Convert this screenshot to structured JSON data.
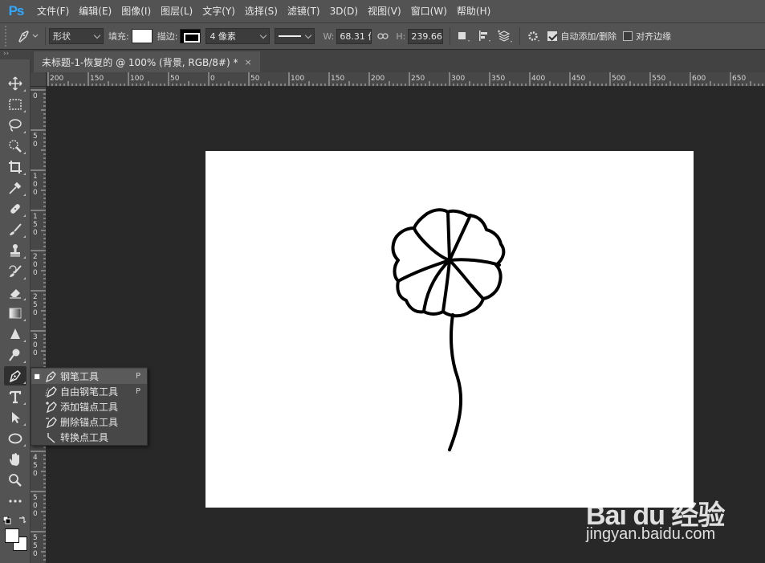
{
  "app": {
    "logo": "Ps"
  },
  "menubar": {
    "items": [
      "文件(F)",
      "编辑(E)",
      "图像(I)",
      "图层(L)",
      "文字(Y)",
      "选择(S)",
      "滤镜(T)",
      "3D(D)",
      "视图(V)",
      "窗口(W)",
      "帮助(H)"
    ]
  },
  "options": {
    "mode": "形状",
    "fill_label": "填充:",
    "stroke_label": "描边:",
    "stroke_width": "4 像素",
    "width_label": "W:",
    "width_value": "68.31 像",
    "height_label": "H:",
    "height_value": "239.66 像",
    "auto_add_delete_label": "自动添加/删除",
    "auto_add_delete_checked": true,
    "align_edges_label": "对齐边缘",
    "align_edges_checked": false
  },
  "document": {
    "tab_title": "未标题-1-恢复的 @ 100% (背景, RGB/8#) *",
    "close_glyph": "×"
  },
  "rulers": {
    "top_labels": [
      "200",
      "150",
      "100",
      "50",
      "0",
      "50",
      "100",
      "150",
      "200",
      "250",
      "300",
      "350",
      "400",
      "450",
      "500",
      "550",
      "600",
      "650"
    ],
    "left_labels": [
      "0",
      "5\n0",
      "1\n0\n0",
      "1\n5\n0",
      "2\n0\n0",
      "2\n5\n0",
      "3\n0\n0",
      "3\n5\n0",
      "4\n0\n0",
      "4\n5\n0",
      "5\n0\n0",
      "5\n5\n0"
    ]
  },
  "flyout": {
    "items": [
      {
        "label": "钢笔工具",
        "shortcut": "P",
        "selected": true
      },
      {
        "label": "自由钢笔工具",
        "shortcut": "P",
        "selected": false
      },
      {
        "label": "添加锚点工具",
        "shortcut": "",
        "selected": false
      },
      {
        "label": "删除锚点工具",
        "shortcut": "",
        "selected": false
      },
      {
        "label": "转换点工具",
        "shortcut": "",
        "selected": false
      }
    ]
  },
  "watermark": {
    "brand": "Bai du 经验",
    "url": "jingyan.baidu.com"
  },
  "colors": {
    "panel": "#535353",
    "workspace": "#282828",
    "canvas": "#ffffff",
    "accent_logo": "#31a8ff"
  }
}
